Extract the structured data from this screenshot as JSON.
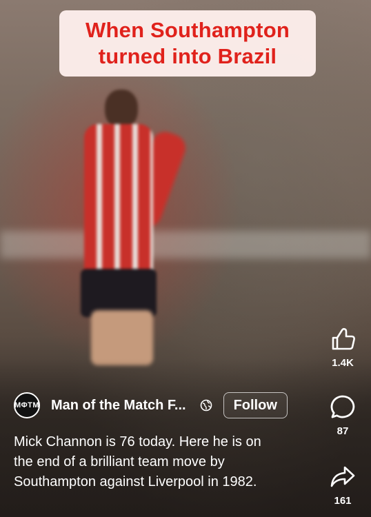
{
  "overlay": {
    "caption_line1": "When Southampton",
    "caption_line2": "turned into Brazil"
  },
  "actions": {
    "like_count": "1.4K",
    "comment_count": "87",
    "share_count": "161"
  },
  "channel": {
    "avatar_text": "MΦTM",
    "name": "Man of the Match F...",
    "follow_label": "Follow"
  },
  "description": {
    "line1": "Mick Channon is 76 today. Here he is on",
    "line2": "the end of a brilliant team move by",
    "line3": "Southampton against Liverpool in 1982."
  },
  "icons": [
    "thumbs-up-icon",
    "comment-icon",
    "share-icon",
    "globe-icon"
  ],
  "colors": {
    "caption_text": "#e0221c",
    "caption_bg": "#fff0ee"
  }
}
